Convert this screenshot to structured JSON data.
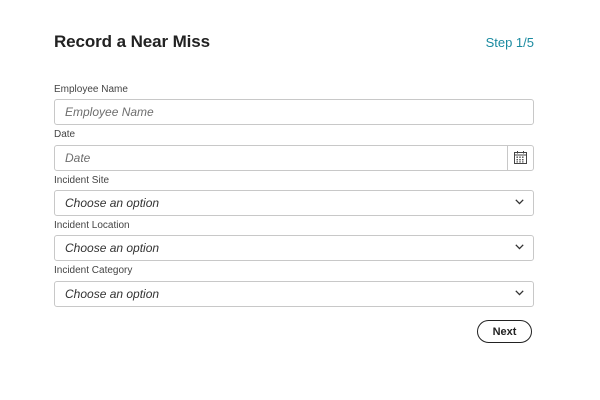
{
  "header": {
    "title": "Record a Near Miss",
    "step": "Step 1/5"
  },
  "form": {
    "employee_name": {
      "label": "Employee Name",
      "placeholder": "Employee Name"
    },
    "date": {
      "label": "Date",
      "placeholder": "Date"
    },
    "incident_site": {
      "label": "Incident Site",
      "value": "Choose an option"
    },
    "incident_location": {
      "label": "Incident Location",
      "value": "Choose an option"
    },
    "incident_category": {
      "label": "Incident Category",
      "value": "Choose an option"
    }
  },
  "actions": {
    "next_label": "Next"
  },
  "colors": {
    "accent": "#1a8aa0",
    "border": "#c8c8c8",
    "text": "#222222"
  }
}
